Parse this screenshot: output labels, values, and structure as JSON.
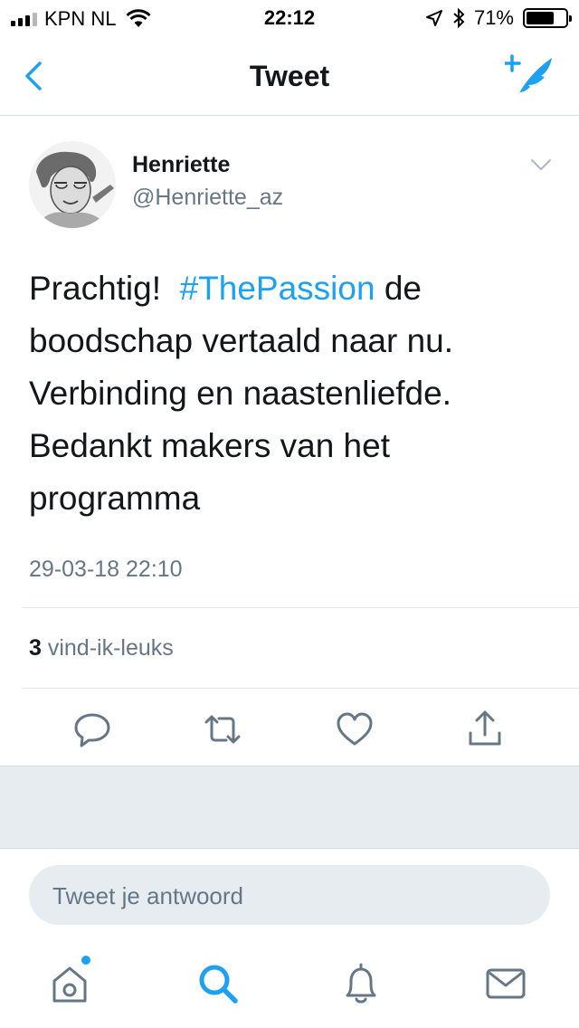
{
  "status_bar": {
    "carrier": "KPN NL",
    "time": "22:12",
    "battery_percent": "71%",
    "battery_level": 0.71,
    "icons": [
      "signal-icon",
      "wifi-icon",
      "location-arrow-icon",
      "bluetooth-icon",
      "battery-icon"
    ]
  },
  "nav": {
    "title": "Tweet",
    "back_icon": "chevron-left-icon",
    "compose_icon": "compose-tweet-icon"
  },
  "tweet": {
    "author_name": "Henriette",
    "author_handle": "@Henriette_az",
    "text_before": "Prachtig!  ",
    "hashtag": "#ThePassion",
    "text_after": " de boodschap vertaald naar nu. Verbinding en naastenliefde. Bedankt makers van het programma",
    "timestamp": "29-03-18 22:10",
    "like_count": "3",
    "like_label": " vind-ik-leuks"
  },
  "reply": {
    "placeholder": "Tweet je antwoord"
  },
  "tabs": [
    "home-icon",
    "search-icon",
    "notifications-icon",
    "messages-icon"
  ],
  "colors": {
    "accent": "#1da1f2",
    "secondary_text": "#657786",
    "primary_text": "#14171a",
    "section_gray": "#e6ecf0"
  }
}
